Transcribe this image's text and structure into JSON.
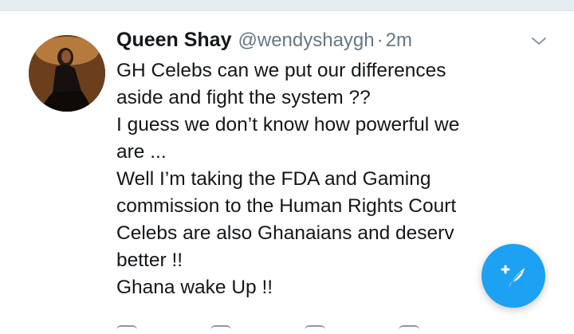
{
  "tweet": {
    "display_name": "Queen Shay",
    "handle": "@wendyshaygh",
    "separator": "·",
    "time": "2m",
    "lines": [
      "GH Celebs can we put our differences",
      "aside and fight the system ??",
      "I guess we don’t know how powerful we",
      "are ...",
      "Well I’m taking the FDA and Gaming",
      "commission to the Human Rights Court",
      "Celebs are also Ghanaians and deserv",
      "better !!",
      "Ghana wake Up !!"
    ]
  },
  "icons": {
    "avatar": "profile-photo",
    "menu": "chevron-down-icon",
    "compose": "compose-tweet-icon"
  },
  "colors": {
    "accent": "#1da1f2",
    "text": "#14171a",
    "secondary": "#657786"
  }
}
